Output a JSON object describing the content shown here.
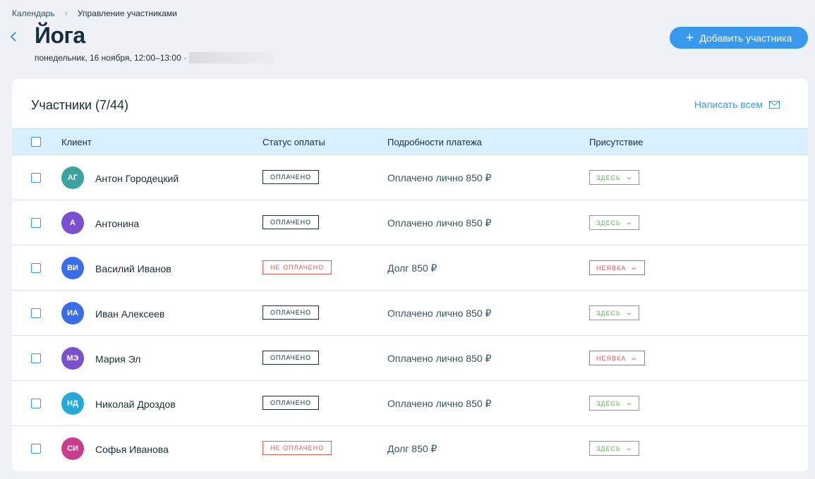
{
  "breadcrumb": {
    "root": "Календарь",
    "current": "Управление участниками"
  },
  "header": {
    "title": "Йога",
    "subtitle": "понедельник, 16 ноября, 12:00–13:00 ·",
    "add_button": "Добавить участника"
  },
  "participants": {
    "title": "Участники (7/44)",
    "write_all": "Написать всем",
    "columns": {
      "client": "Клиент",
      "payment_status": "Статус оплаты",
      "payment_details": "Подробности платежа",
      "presence": "Присутствие"
    },
    "rows": [
      {
        "initials": "АГ",
        "avatar_color": "#3da3a0",
        "name": "Антон Городецкий",
        "payment_status": "ОПЛАЧЕНО",
        "paid": true,
        "details": "Оплачено лично 850 ₽",
        "presence": "ЗДЕСЬ",
        "present": true
      },
      {
        "initials": "А",
        "avatar_color": "#7a4fd0",
        "name": "Антонина",
        "payment_status": "ОПЛАЧЕНО",
        "paid": true,
        "details": "Оплачено лично 850 ₽",
        "presence": "ЗДЕСЬ",
        "present": true
      },
      {
        "initials": "ВИ",
        "avatar_color": "#3a6ee8",
        "name": "Василий Иванов",
        "payment_status": "НЕ ОПЛАЧЕНО",
        "paid": false,
        "details": "Долг 850 ₽",
        "presence": "НЕЯВКА",
        "present": false
      },
      {
        "initials": "ИА",
        "avatar_color": "#3a6ee8",
        "name": "Иван Алексеев",
        "payment_status": "ОПЛАЧЕНО",
        "paid": true,
        "details": "Оплачено лично 850 ₽",
        "presence": "ЗДЕСЬ",
        "present": true
      },
      {
        "initials": "МЭ",
        "avatar_color": "#7a4fd0",
        "name": "Мария Эл",
        "payment_status": "ОПЛАЧЕНО",
        "paid": true,
        "details": "Оплачено лично 850 ₽",
        "presence": "НЕЯВКА",
        "present": false
      },
      {
        "initials": "НД",
        "avatar_color": "#27a9d8",
        "name": "Николай Дроздов",
        "payment_status": "ОПЛАЧЕНО",
        "paid": true,
        "details": "Оплачено лично 850 ₽",
        "presence": "ЗДЕСЬ",
        "present": true
      },
      {
        "initials": "СИ",
        "avatar_color": "#c93c8e",
        "name": "Софья Иванова",
        "payment_status": "НЕ ОПЛАЧЕНО",
        "paid": false,
        "details": "Долг 850 ₽",
        "presence": "ЗДЕСЬ",
        "present": true
      }
    ]
  }
}
